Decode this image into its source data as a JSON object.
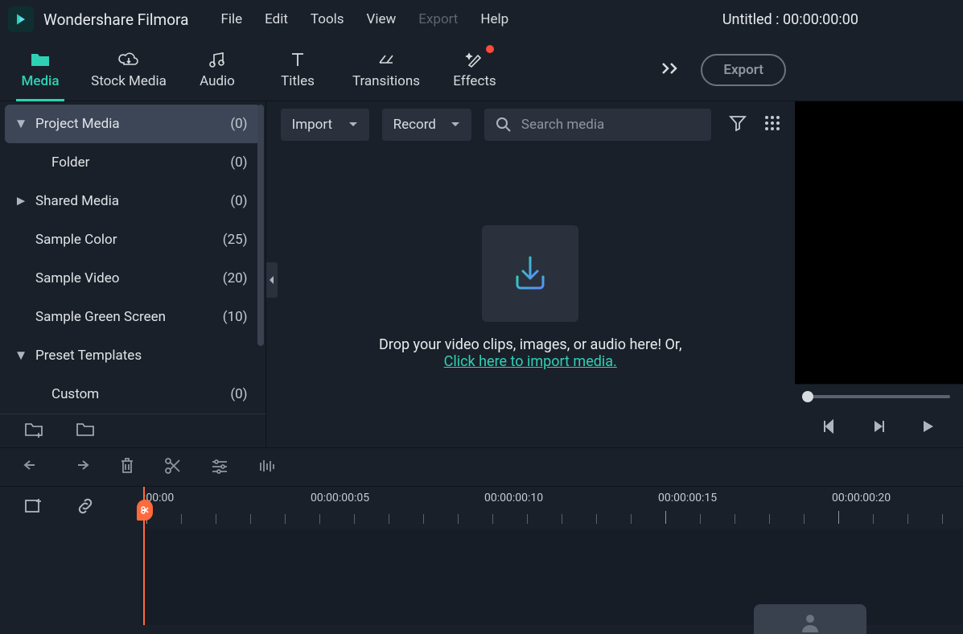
{
  "app": {
    "title": "Wondershare Filmora"
  },
  "menu": {
    "file": "File",
    "edit": "Edit",
    "tools": "Tools",
    "view": "View",
    "export": "Export",
    "help": "Help"
  },
  "document": {
    "title": "Untitled : 00:00:00:00"
  },
  "tabs": {
    "media": "Media",
    "stock": "Stock Media",
    "audio": "Audio",
    "titles": "Titles",
    "transitions": "Transitions",
    "effects": "Effects"
  },
  "export_btn": "Export",
  "sidebar": {
    "items": [
      {
        "label": "Project Media",
        "count": "(0)",
        "caret": "▼",
        "indent": 0,
        "selected": true
      },
      {
        "label": "Folder",
        "count": "(0)",
        "caret": "",
        "indent": 1,
        "selected": false
      },
      {
        "label": "Shared Media",
        "count": "(0)",
        "caret": "►",
        "indent": 0,
        "selected": false
      },
      {
        "label": "Sample Color",
        "count": "(25)",
        "caret": "",
        "indent": 0,
        "selected": false
      },
      {
        "label": "Sample Video",
        "count": "(20)",
        "caret": "",
        "indent": 0,
        "selected": false
      },
      {
        "label": "Sample Green Screen",
        "count": "(10)",
        "caret": "",
        "indent": 0,
        "selected": false
      },
      {
        "label": "Preset Templates",
        "count": "",
        "caret": "▼",
        "indent": 0,
        "selected": false
      },
      {
        "label": "Custom",
        "count": "(0)",
        "caret": "",
        "indent": 1,
        "selected": false
      }
    ]
  },
  "media_toolbar": {
    "import": "Import",
    "record": "Record",
    "search_placeholder": "Search media"
  },
  "drop": {
    "line1": "Drop your video clips, images, or audio here! Or,",
    "link": "Click here to import media."
  },
  "timeline": {
    "labels": [
      ":00:00",
      "00:00:00:05",
      "00:00:00:10",
      "00:00:00:15",
      "00:00:00:20"
    ]
  }
}
